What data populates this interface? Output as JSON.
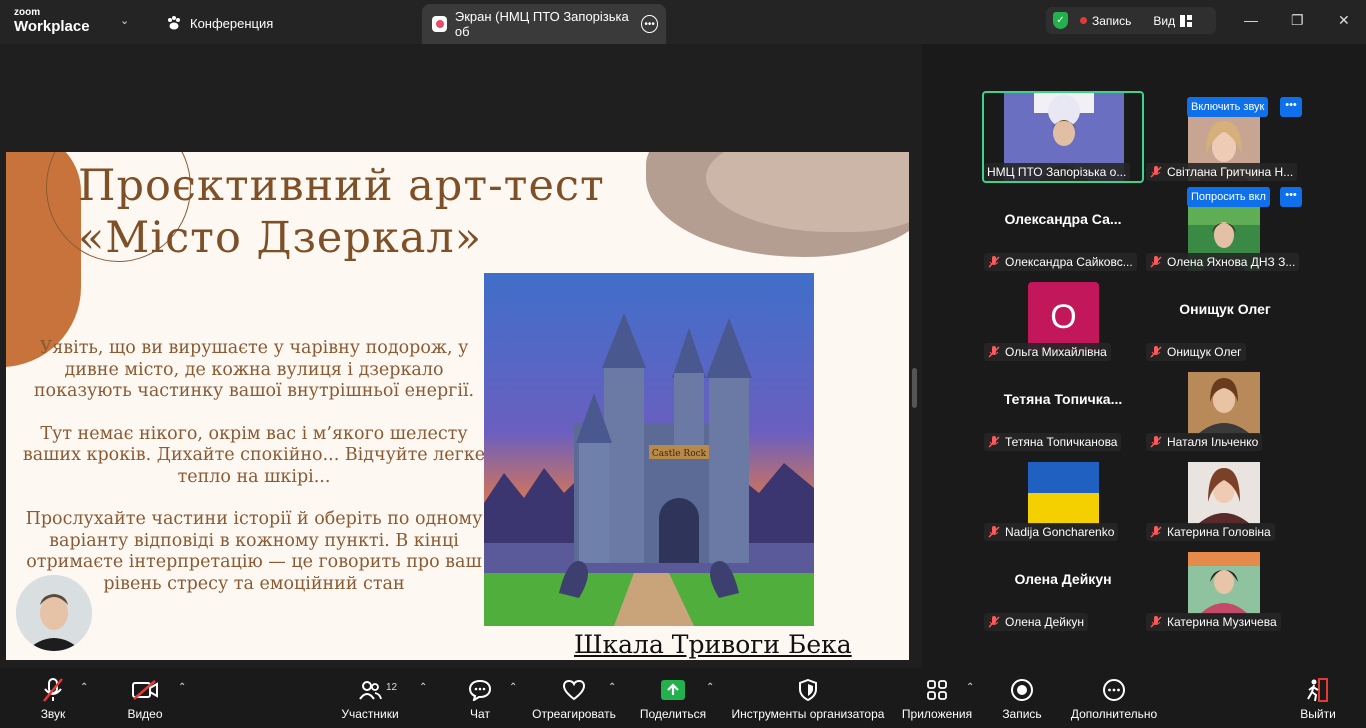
{
  "app": {
    "logo_line1": "zoom",
    "logo_line2": "Workplace"
  },
  "tabs": {
    "conference": "Конференция",
    "screen": "Экран (НМЦ ПТО Запорізька об"
  },
  "header": {
    "recording": "Запись",
    "view": "Вид"
  },
  "slide": {
    "title_line1": "Проєктивний арт-тест",
    "title_line2": "«Місто Дзеркал»",
    "para1": "Уявіть, що ви вирушаєте у чарівну подорож, у дивне місто, де кожна вулиця і дзеркало показують частинку вашої внутрішньої енергії.",
    "para2": "Тут немає нікого, окрім вас і м’якого шелесту ваших кроків. Дихайте спокійно... Відчуйте легке тепло на шкірі...",
    "para3": "Прослухайте частини історії й оберіть по одному варіанту відповіді в кожному пункті. В кінці отримаєте інтерпретацію — це говорить про ваш рівень стресу та емоційний стан",
    "castle_sign": "Castle Rock",
    "link": "Шкала Тривоги Бека"
  },
  "participants": [
    {
      "name": "НМЦ ПТО Запорізька о...",
      "muted": false,
      "type": "video"
    },
    {
      "name": "Світлана Гритчина Н...",
      "muted": true,
      "type": "video",
      "pill": "Включить звук"
    },
    {
      "name": "Олександра Сайковс...",
      "display": "Олександра  Са...",
      "muted": true,
      "type": "name"
    },
    {
      "name": "Олена Яхнова ДНЗ З...",
      "muted": true,
      "type": "video",
      "pill": "Попросить вкл"
    },
    {
      "name": "Ольга Михайлівна",
      "muted": true,
      "type": "avatar",
      "letter": "О"
    },
    {
      "name": "Онищук Олег",
      "display": "Онищук Олег",
      "muted": true,
      "type": "name"
    },
    {
      "name": "Тетяна Топичканова",
      "display": "Тетяна  Топичка...",
      "muted": true,
      "type": "name"
    },
    {
      "name": "Наталя Ільченко",
      "muted": true,
      "type": "video"
    },
    {
      "name": "Nadija Goncharenko",
      "muted": true,
      "type": "flag"
    },
    {
      "name": "Катерина Головіна",
      "muted": true,
      "type": "video"
    },
    {
      "name": "Олена Дейкун",
      "display": "Олена Дейкун",
      "muted": true,
      "type": "name"
    },
    {
      "name": "Катерина Музичева",
      "muted": true,
      "type": "video"
    }
  ],
  "toolbar": {
    "audio": "Звук",
    "video": "Видео",
    "participants": "Участники",
    "participants_count": "12",
    "chat": "Чат",
    "react": "Отреагировать",
    "share": "Поделиться",
    "host_tools": "Инструменты организатора",
    "apps": "Приложения",
    "record": "Запись",
    "more": "Дополнительно",
    "leave": "Выйти"
  },
  "colors": {
    "accent_green": "#22b14c",
    "record_red": "#e53935",
    "blue": "#0e71eb",
    "active_border": "#3ed38b",
    "slide_brown": "#7e5027"
  }
}
